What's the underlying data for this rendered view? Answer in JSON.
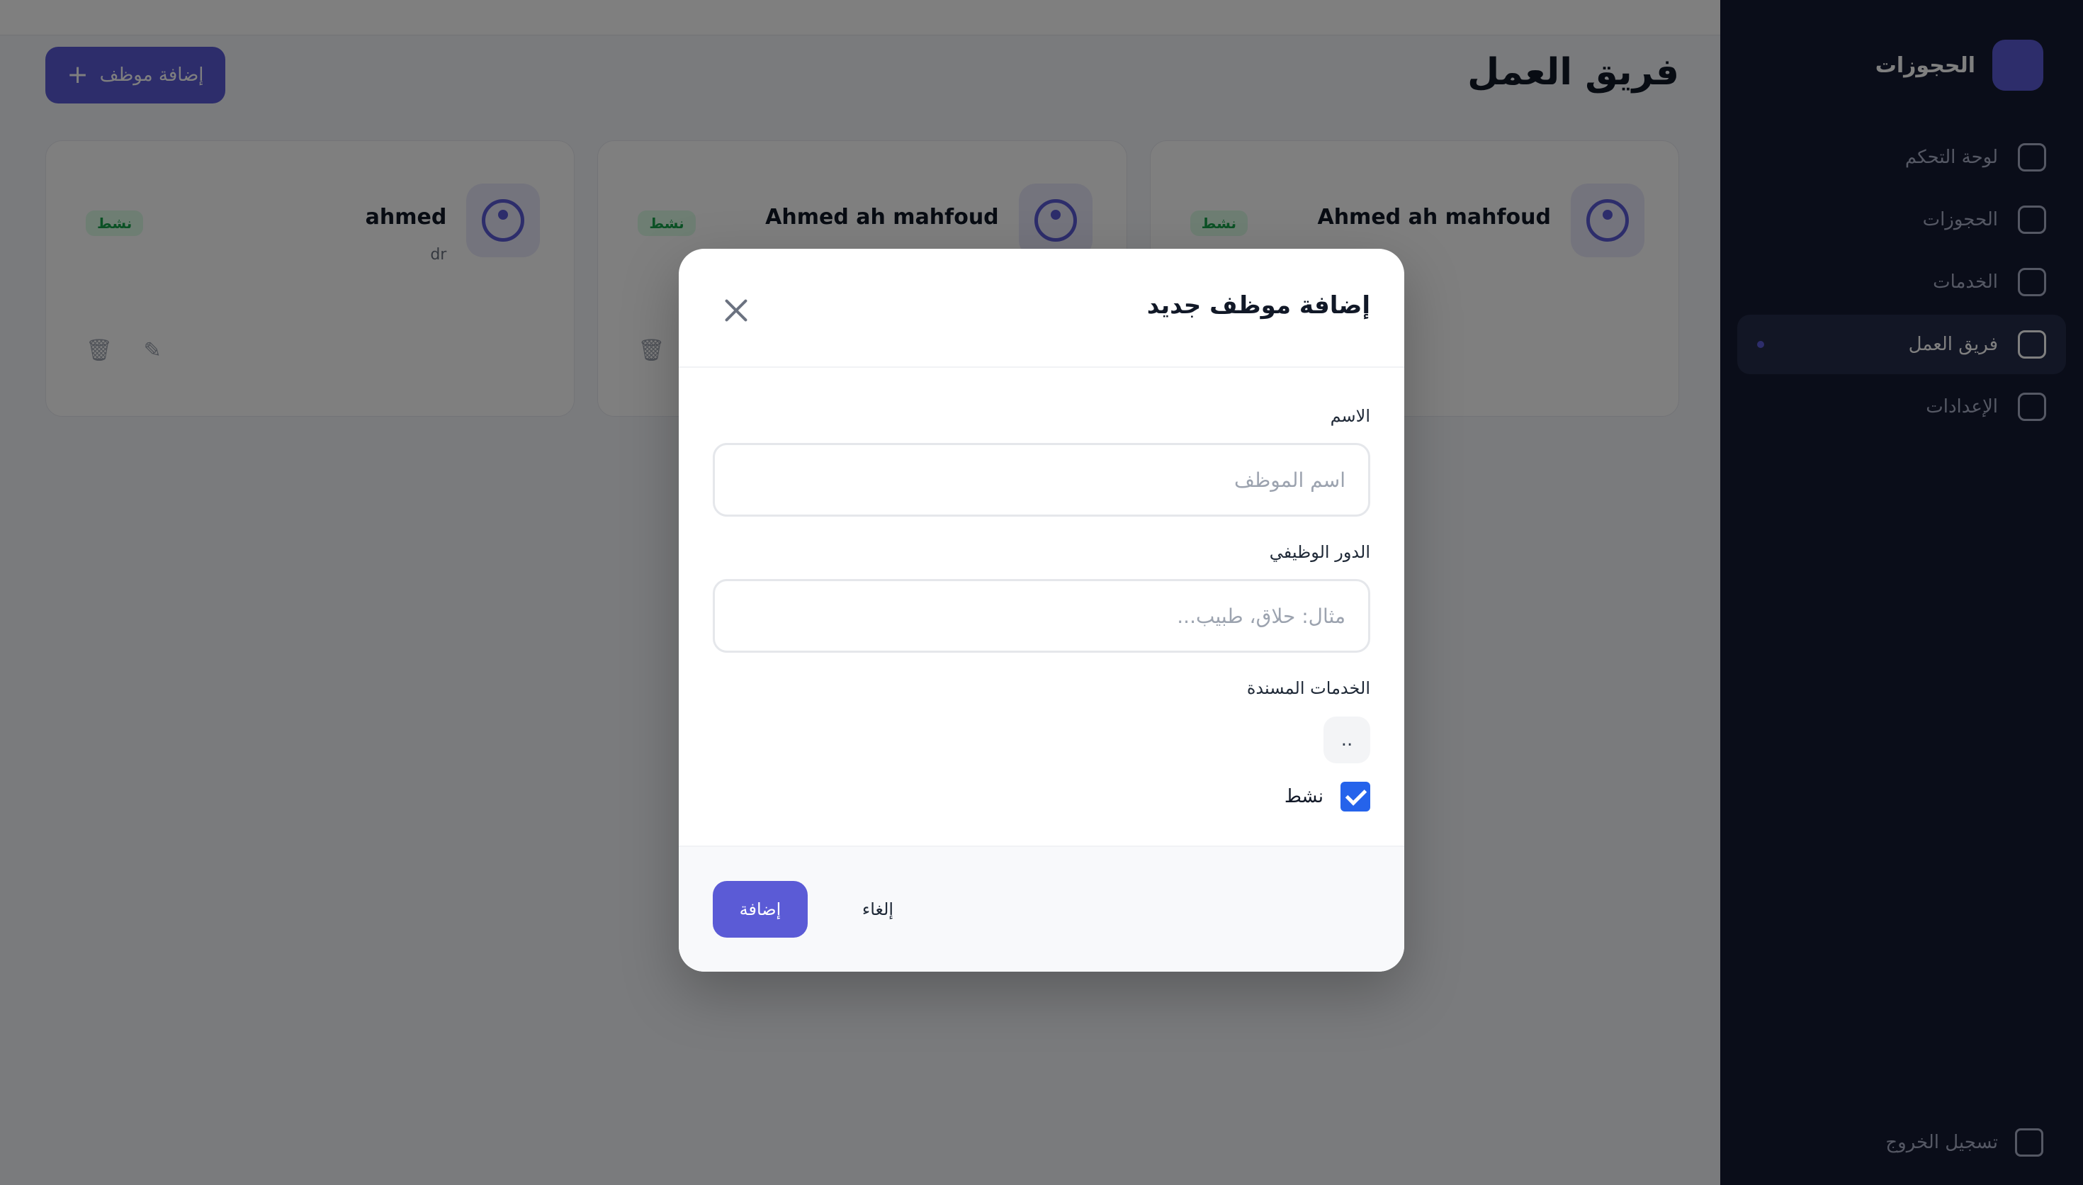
{
  "page": {
    "title": "فريق العمل",
    "add_button_label": "إضافة موظف"
  },
  "sidebar": {
    "brand": "الحجوزات",
    "items": [
      {
        "label": "لوحة التحكم",
        "icon": "dashboard-icon"
      },
      {
        "label": "الحجوزات",
        "icon": "calendar-icon"
      },
      {
        "label": "الخدمات",
        "icon": "briefcase-icon"
      },
      {
        "label": "فريق العمل",
        "icon": "users-icon",
        "active": true
      },
      {
        "label": "الإعدادات",
        "icon": "gear-icon"
      }
    ],
    "logout_label": "تسجيل الخروج"
  },
  "team_cards": [
    {
      "name": "Ahmed ah mahfoud",
      "role": "",
      "status": "نشط"
    },
    {
      "name": "Ahmed ah mahfoud",
      "role": "",
      "status": "نشط"
    },
    {
      "name": "ahmed",
      "role": "dr",
      "status": "نشط"
    }
  ],
  "modal": {
    "title": "إضافة موظف جديد",
    "name_label": "الاسم",
    "name_placeholder": "اسم الموظف",
    "name_value": "",
    "role_label": "الدور الوظيفي",
    "role_placeholder": "مثال: حلاق، طبيب...",
    "role_value": "",
    "services_label": "الخدمات المسندة",
    "services_value": "..",
    "active_label": "نشط",
    "active_checked": true,
    "submit_label": "إضافة",
    "cancel_label": "إلغاء"
  },
  "colors": {
    "primary": "#5b5bd6",
    "sidebar_bg": "#141a33",
    "checkbox": "#2563eb",
    "status_green": "#16a34a"
  }
}
